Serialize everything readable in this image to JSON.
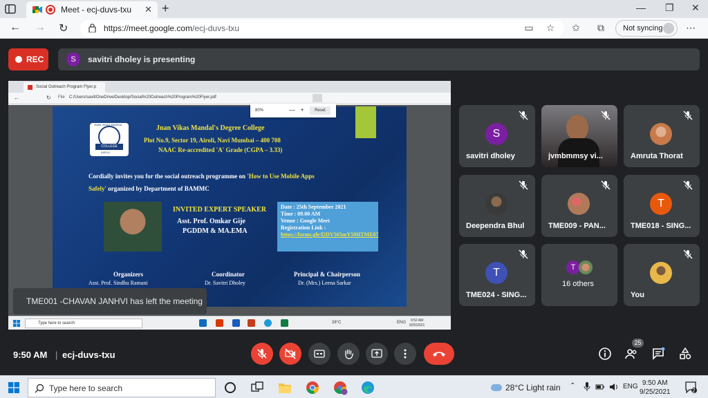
{
  "browser": {
    "tab_title": "Meet - ecj-duvs-txu",
    "tab_close": "✕",
    "new_tab": "+",
    "url_host": "https://meet.google.com",
    "url_path": "/ecj-duvs-txu",
    "sync_label": "Not syncing",
    "more": "⋯"
  },
  "meet": {
    "rec_label": "REC",
    "presenter_initial": "S",
    "presenting_text": "savitri dholey is presenting",
    "toast": "TME001 -CHAVAN JANHVI has left the meeting",
    "time": "9:50 AM",
    "separator": "|",
    "meeting_code": "ecj-duvs-txu",
    "participants_count": "25",
    "tiles": [
      {
        "name": "savitri dholey",
        "initial": "S",
        "color": "#7b1fa2"
      },
      {
        "name": "jvmbmmsy vi...",
        "initial": "",
        "color": ""
      },
      {
        "name": "Amruta Thorat",
        "initial": "",
        "color": "#c87a4b"
      },
      {
        "name": "Deependra Bhul",
        "initial": "",
        "color": "#5a5a5a"
      },
      {
        "name": "TME009 - PAN...",
        "initial": "",
        "color": "#8a6a5a"
      },
      {
        "name": "TME018 - SING...",
        "initial": "T",
        "color": "#e8590c"
      },
      {
        "name": "TME024 - SING...",
        "initial": "T",
        "color": "#3f51b5"
      },
      {
        "name": "16 others",
        "initial": "T",
        "color": "#7b1fa2"
      },
      {
        "name": "You",
        "initial": "",
        "color": "#e8b94a"
      }
    ]
  },
  "shared_screen": {
    "tab_title": "Social Outreach Program Flyer.p",
    "file_label": "File",
    "file_path": "C:/Users/savit/OneDrive/Desktop/Social%20Outreach%20Program%20Flyer.pdf",
    "zoom_value": "80%",
    "zoom_minus": "—",
    "zoom_plus": "+",
    "zoom_reset": "Reset",
    "flyer": {
      "logo_band": "COLLEGE",
      "logo_place": "AIROLI",
      "logo_top": "JNAN VIKAS MANDAL",
      "college": "Jnan Vikas Mandal's Degree College",
      "address": "Plot No.9, Sector 19, Airoli, Navi Mumbai – 400 708",
      "naac": "NAAC Re-accredited 'A' Grade (CGPA – 3.33)",
      "invite_line1_a": "Cordially invites you for the social outreach  programme on ",
      "invite_line1_b": "'How to Use Mobile Apps",
      "invite_line2_a": "Safely'",
      "invite_line2_b": " organized by Department of BAMMC",
      "speaker_heading": "INVITED EXPERT SPEAKER",
      "speaker_name": "Asst. Prof. Omkar Gije",
      "speaker_qual": "PGDDM & MA.EMA",
      "date": "Date : 25th September 2021",
      "time": "Time : 09.00 AM",
      "venue": "Venue : Google Meet",
      "reg": "Registration Link :",
      "link": "https://forms.gle/f2DV565mY59HTME87",
      "org1_title": "Organizers",
      "org1_name": "Asst. Prof. Sindhu Ramani",
      "org2_title": "Coordinator",
      "org2_name": "Dr. Savitri Dholey",
      "org3_title": "Principal & Chairperson",
      "org3_name": "Dr. (Mrs.) Leena Sarkar"
    },
    "taskbar_search": "Type here to search",
    "taskbar_temp": "28°C",
    "taskbar_lang": "ENG",
    "taskbar_time": "9:52 AM",
    "taskbar_date": "9/25/2021"
  },
  "taskbar": {
    "search_placeholder": "Type here to search",
    "weather": "28°C  Light rain",
    "lang": "ENG",
    "time": "9:50 AM",
    "date": "9/25/2021",
    "notifications": "2"
  }
}
